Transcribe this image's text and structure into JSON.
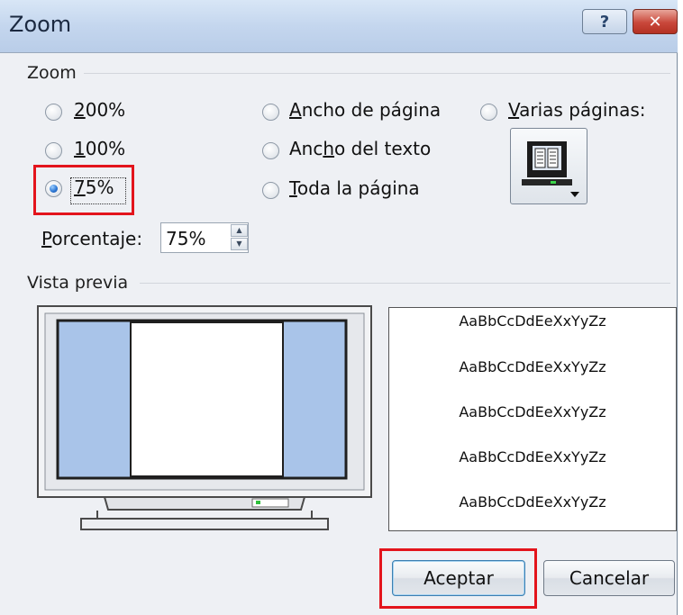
{
  "window": {
    "title": "Zoom",
    "help_glyph": "?",
    "close_glyph": "✕"
  },
  "zoom_group": {
    "legend": "Zoom",
    "options": [
      {
        "label": "200%",
        "selected": false
      },
      {
        "label": "100%",
        "selected": false
      },
      {
        "label": "75%",
        "selected": true
      },
      {
        "label": "Ancho de página",
        "selected": false
      },
      {
        "label": "Ancho del texto",
        "selected": false
      },
      {
        "label": "Toda la página",
        "selected": false
      },
      {
        "label": "Varias páginas:",
        "selected": false
      }
    ],
    "percent_label": "Porcentaje:",
    "percent_value": "75%",
    "pages_button_icon": "monitor-pages-icon"
  },
  "preview_group": {
    "legend": "Vista previa",
    "sample_text": [
      "AaBbCcDdEeXxYyZz",
      "AaBbCcDdEeXxYyZz",
      "AaBbCcDdEeXxYyZz",
      "AaBbCcDdEeXxYyZz",
      "AaBbCcDdEeXxYyZz"
    ]
  },
  "buttons": {
    "ok": "Aceptar",
    "cancel": "Cancelar"
  },
  "colors": {
    "highlight": "#e3141c",
    "page_margin": "#a9c4e9",
    "radio_selected": "#2f7ad6"
  }
}
